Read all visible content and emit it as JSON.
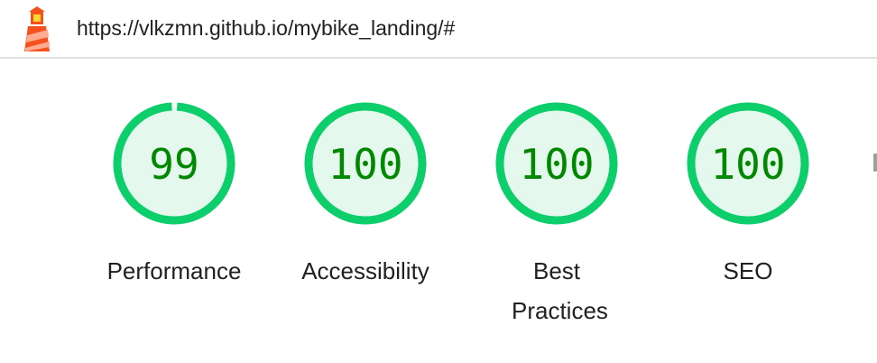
{
  "header": {
    "url": "https://vlkzmn.github.io/mybike_landing/#",
    "logo_icon": "lighthouse-icon"
  },
  "colors": {
    "pass_ring": "#0cce6b",
    "pass_fill": "#e5f8ee",
    "pass_text": "#008800"
  },
  "gauges": [
    {
      "score": "99",
      "value": 99,
      "label": "Performance"
    },
    {
      "score": "100",
      "value": 100,
      "label": "Accessibility"
    },
    {
      "score": "100",
      "value": 100,
      "label": "Best Practices"
    },
    {
      "score": "100",
      "value": 100,
      "label": "SEO"
    }
  ]
}
